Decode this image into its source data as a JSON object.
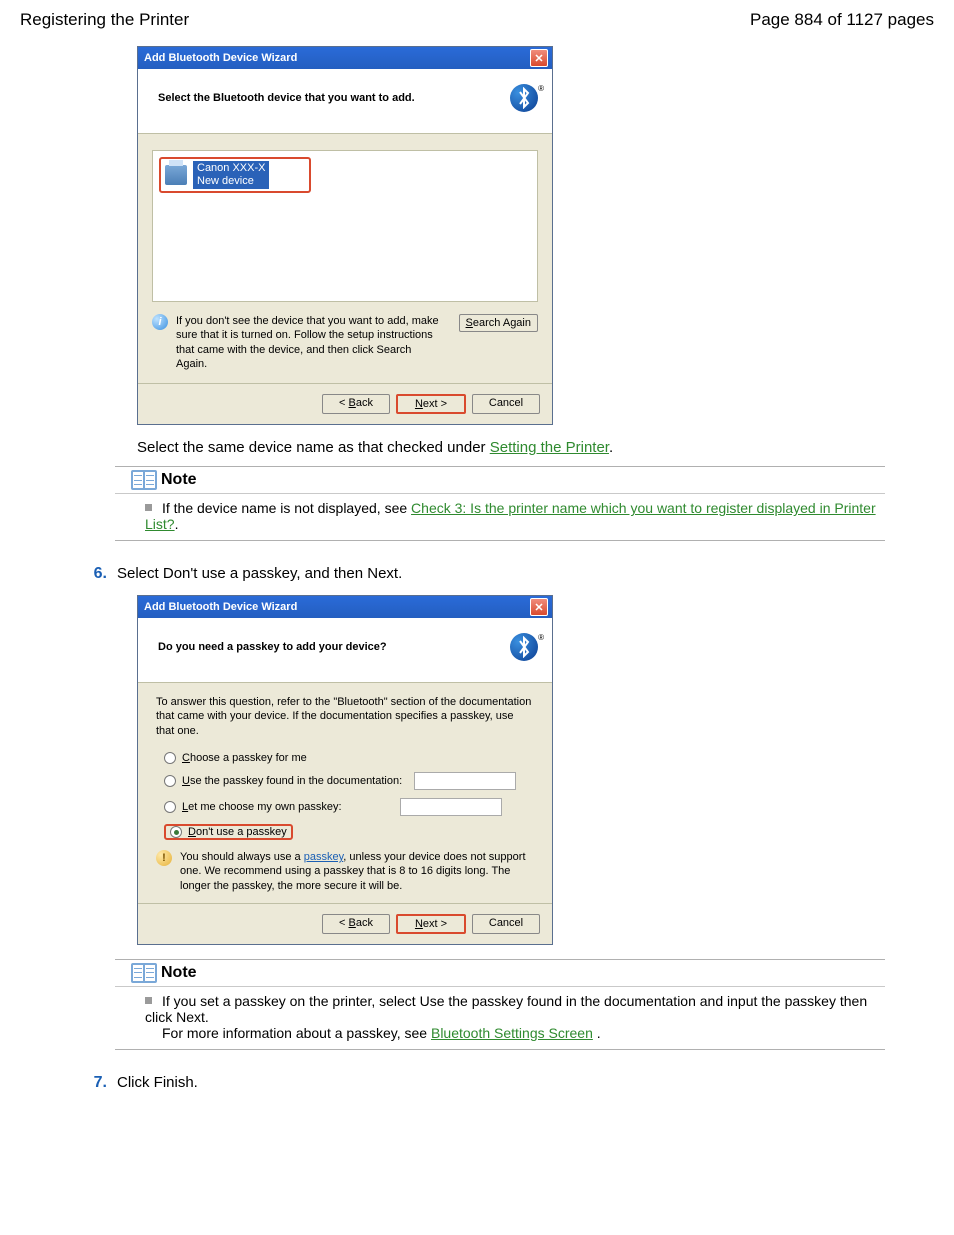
{
  "header": {
    "title": "Registering the Printer",
    "page_label": "Page 884 of 1127 pages"
  },
  "wizard1": {
    "title": "Add Bluetooth Device Wizard",
    "heading": "Select the Bluetooth device that you want to add.",
    "device_name": "Canon XXX-X",
    "device_status": "New device",
    "info_text": "If you don't see the device that you want to add, make sure that it is turned on. Follow the setup instructions that came with the device, and then click Search Again.",
    "search_again": "Search Again",
    "back": "< Back",
    "next": "Next >",
    "cancel": "Cancel"
  },
  "line_after_wizard1": {
    "prefix": "Select the same device name as that checked under ",
    "link": "Setting the Printer",
    "suffix": "."
  },
  "note1": {
    "title": "Note",
    "bullet_prefix": "If the device name is not displayed, see ",
    "link": "Check 3: Is the printer name which you want to register displayed in Printer List?",
    "suffix": "."
  },
  "step6": {
    "num": "6.",
    "text": "Select Don't use a passkey, and then Next."
  },
  "wizard2": {
    "title": "Add Bluetooth Device Wizard",
    "heading": "Do you need a passkey to add your device?",
    "intro": "To answer this question, refer to the \"Bluetooth\" section of the documentation that came with your device. If the documentation specifies a passkey, use that one.",
    "opt_choose": "Choose a passkey for me",
    "opt_fromdoc": "Use the passkey found in the documentation:",
    "opt_own": "Let me choose my own passkey:",
    "opt_none": "Don't use a passkey",
    "warn_prefix": "You should always use a ",
    "warn_link": "passkey",
    "warn_suffix": ", unless your device does not support one. We recommend using a passkey that is 8 to 16 digits long. The longer the passkey, the more secure it will be.",
    "back": "< Back",
    "next": "Next >",
    "cancel": "Cancel"
  },
  "note2": {
    "title": "Note",
    "line1": "If you set a passkey on the printer, select Use the passkey found in the documentation and input the passkey then click Next.",
    "line2_prefix": "For more information about a passkey, see ",
    "line2_link": "Bluetooth Settings Screen",
    "line2_suffix": " ."
  },
  "step7": {
    "num": "7.",
    "text": "Click Finish."
  }
}
